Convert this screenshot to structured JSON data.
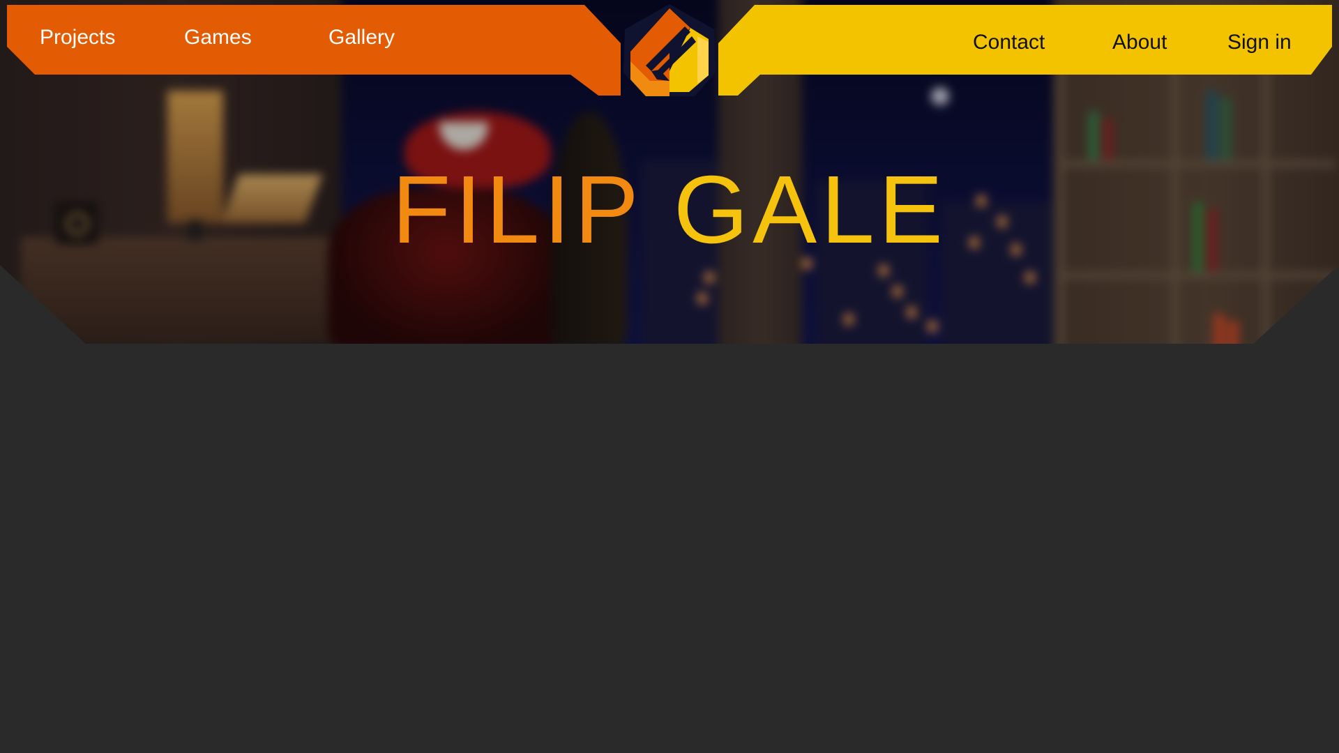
{
  "site": {
    "brand_colors": {
      "orange": "#e35b02",
      "yellow": "#f3c300",
      "page_background": "#2a2a2a"
    }
  },
  "nav": {
    "left_items": [
      {
        "label": "Projects"
      },
      {
        "label": "Games"
      },
      {
        "label": "Gallery"
      }
    ],
    "right_items": [
      {
        "label": "Contact"
      },
      {
        "label": "About"
      },
      {
        "label": "Sign in"
      }
    ],
    "logo_icon": "hexagon-pencil-logo-icon"
  },
  "hero": {
    "title_first": "FILIP",
    "title_last": "GALE",
    "background_icon": "blurred-room-night-city-image"
  }
}
